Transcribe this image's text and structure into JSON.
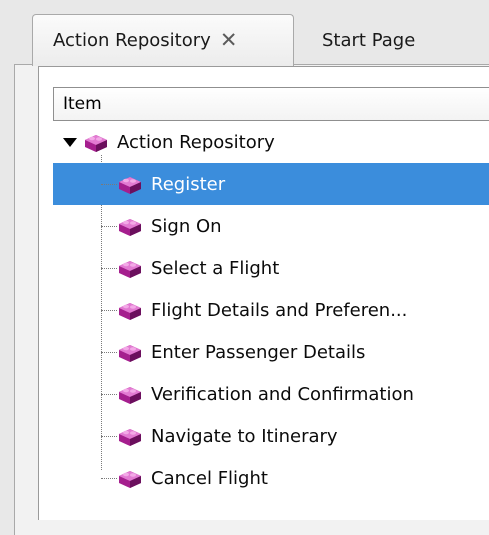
{
  "tabs": [
    {
      "label": "Action Repository",
      "active": true,
      "closable": true,
      "close_icon": "close-icon"
    },
    {
      "label": "Start Page",
      "active": false
    }
  ],
  "table": {
    "column_header": "Item"
  },
  "tree": {
    "root": {
      "label": "Action Repository",
      "expanded": true,
      "icon": "brick-icon",
      "expander_icon": "triangle-down-icon"
    },
    "children": [
      {
        "label": "Register",
        "selected": true,
        "icon": "brick-icon"
      },
      {
        "label": "Sign On",
        "selected": false,
        "icon": "brick-icon"
      },
      {
        "label": "Select a Flight",
        "selected": false,
        "icon": "brick-icon"
      },
      {
        "label": "Flight Details and Preferen...",
        "selected": false,
        "icon": "brick-icon"
      },
      {
        "label": "Enter Passenger Details",
        "selected": false,
        "icon": "brick-icon"
      },
      {
        "label": "Verification and Confirmation",
        "selected": false,
        "icon": "brick-icon"
      },
      {
        "label": "Navigate to Itinerary",
        "selected": false,
        "icon": "brick-icon"
      },
      {
        "label": "Cancel Flight",
        "selected": false,
        "icon": "brick-icon"
      }
    ]
  },
  "colors": {
    "selection": "#3b8ddc",
    "brick": "#a51f8e",
    "brick_dark": "#6b0f5d",
    "brick_light": "#e27ad2"
  }
}
